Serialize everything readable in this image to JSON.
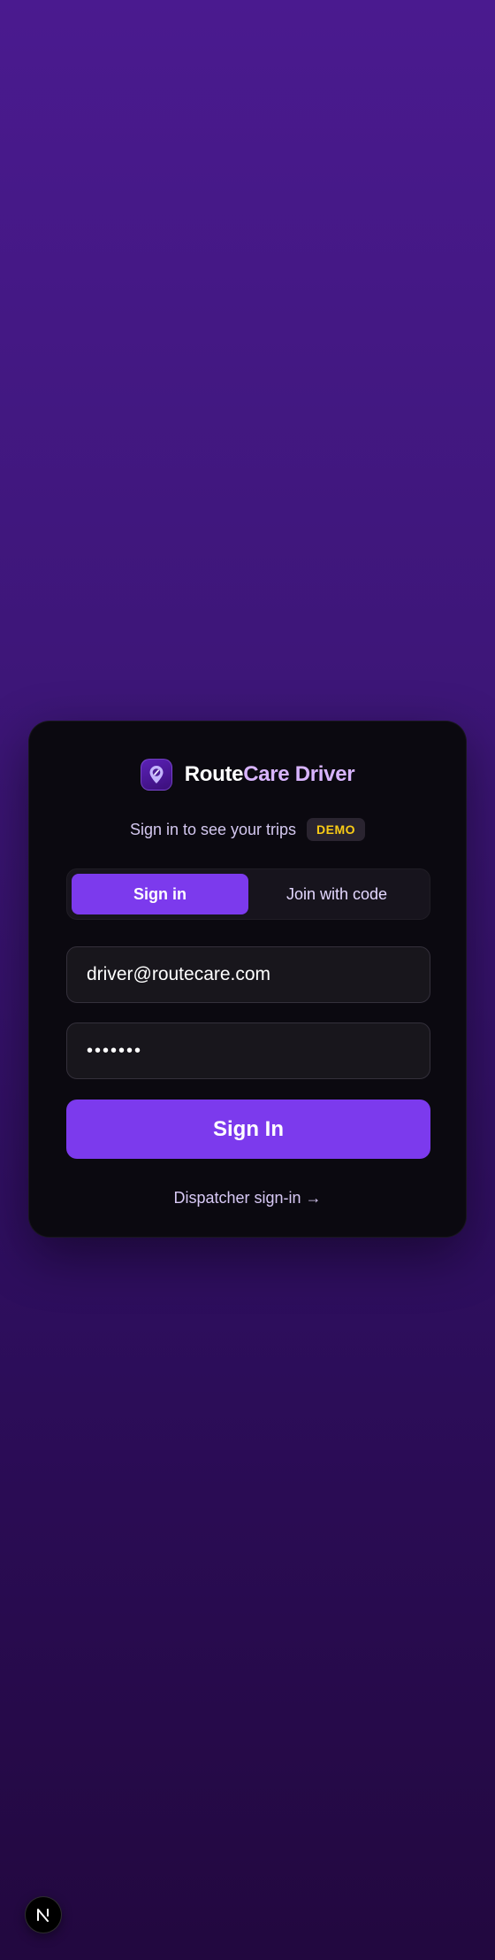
{
  "brand": {
    "name_part1": "Route",
    "name_part2": "Care Driver",
    "logo_icon": "map-pin-logo-icon"
  },
  "subtitle": {
    "text": "Sign in to see your trips",
    "badge": "DEMO"
  },
  "tabs": [
    {
      "label": "Sign in",
      "active": true
    },
    {
      "label": "Join with code",
      "active": false
    }
  ],
  "form": {
    "email_value": "driver@routecare.com",
    "password_masked": "•••••••",
    "submit_label": "Sign In"
  },
  "dispatcher_link": "Dispatcher sign-in →",
  "dev_indicator": {
    "letter": "N",
    "icon": "nextjs-icon"
  },
  "colors": {
    "accent": "#7c3aed",
    "badge_text": "#facc15",
    "brand_secondary": "#d8b4fe",
    "card_bg": "#0b0910"
  }
}
